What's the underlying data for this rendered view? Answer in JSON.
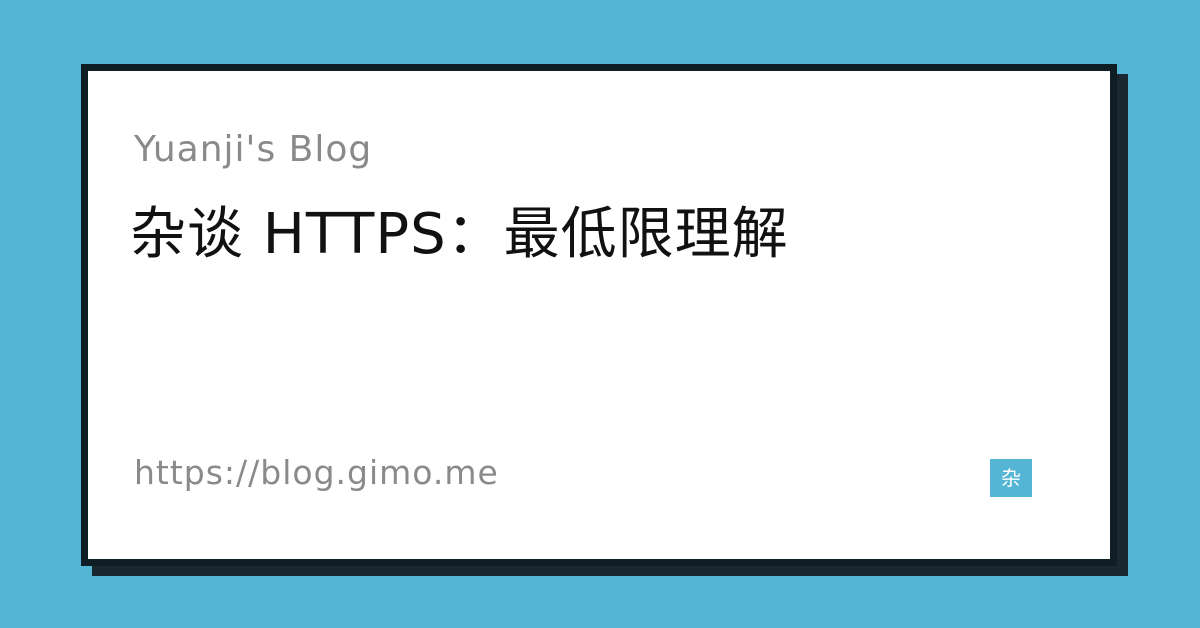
{
  "card": {
    "blog_name": "Yuanji's Blog",
    "title": "杂谈 HTTPS：最低限理解",
    "url": "https://blog.gimo.me",
    "category_tag": "杂"
  },
  "colors": {
    "background": "#55b5d5",
    "card": "#ffffff",
    "border": "#0f1d24",
    "title": "#111111",
    "muted_text": "#8a8a8a",
    "tag_background": "#55b5d5"
  }
}
